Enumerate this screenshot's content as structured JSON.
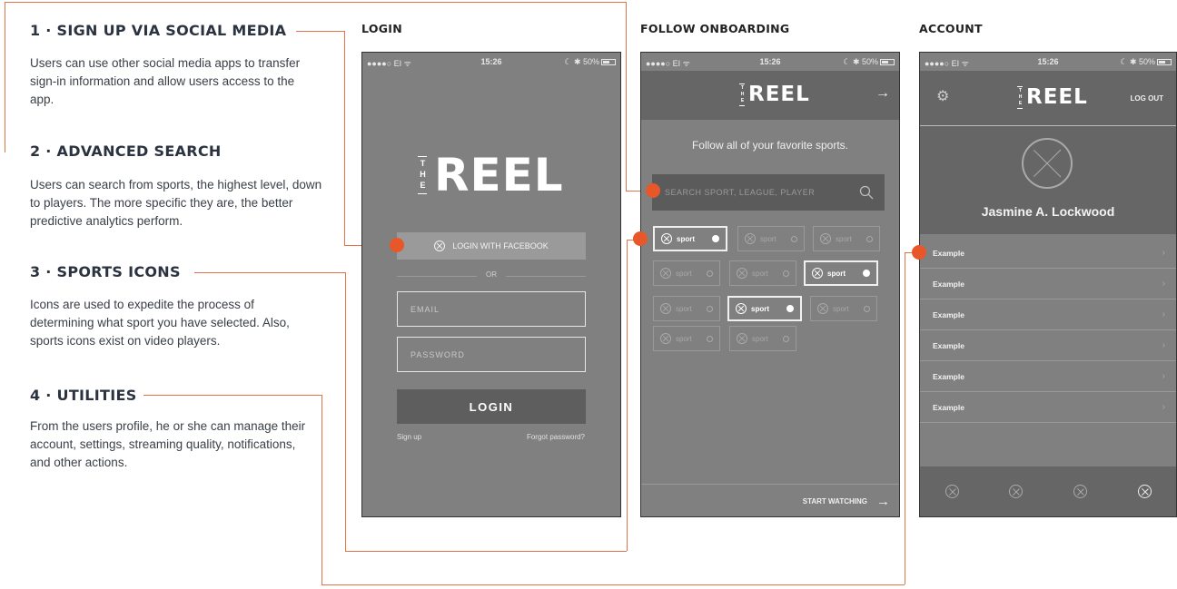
{
  "annotations": [
    {
      "title": "1 · SIGN UP VIA SOCIAL MEDIA",
      "body": "Users can use other social media apps to transfer sign-in information and allow users access to the app."
    },
    {
      "title": "2 · ADVANCED SEARCH",
      "body": "Users can search from sports, the highest level, down to players. The more specific they are, the better predictive analytics perform."
    },
    {
      "title": "3 · SPORTS ICONS",
      "body": "Icons are used to expedite the process of determining what sport you have selected. Also, sports icons exist on video players."
    },
    {
      "title": "4 · UTILITIES",
      "body": "From the users profile, he or she can manage their account, settings, streaming quality, notifications, and other actions."
    }
  ],
  "columns": {
    "login": "LOGIN",
    "onboarding": "FOLLOW ONBOARDING",
    "account": "ACCOUNT"
  },
  "status_bar": {
    "carrier": "●●●●○ EI ᯤ",
    "time": "15:26",
    "battery": "☾ ✱ 50%"
  },
  "logo": {
    "the": "THE",
    "reel": "REEL"
  },
  "login": {
    "facebook_button": "LOGIN WITH FACEBOOK",
    "or": "OR",
    "email_placeholder": "EMAIL",
    "password_placeholder": "PASSWORD",
    "login_button": "LOGIN",
    "sign_up": "Sign up",
    "forgot_password": "Forgot password?"
  },
  "onboarding": {
    "next_arrow": "→",
    "title": "Follow all of your favorite sports.",
    "search_placeholder": "SEARCH SPORT, LEAGUE, PLAYER",
    "chips": [
      {
        "label": "sport",
        "selected": true
      },
      {
        "label": "sport",
        "selected": false
      },
      {
        "label": "sport",
        "selected": false
      },
      {
        "label": "sport",
        "selected": false
      },
      {
        "label": "sport",
        "selected": false
      },
      {
        "label": "sport",
        "selected": true
      },
      {
        "label": "sport",
        "selected": false
      },
      {
        "label": "sport",
        "selected": true
      },
      {
        "label": "sport",
        "selected": false
      },
      {
        "label": "sport",
        "selected": false
      },
      {
        "label": "sport",
        "selected": false
      }
    ],
    "start_watching": "START WATCHING",
    "start_arrow": "→"
  },
  "account": {
    "settings_icon": "⚙",
    "logout": "LOG OUT",
    "name": "Jasmine A. Lockwood",
    "menu_items": [
      "Example",
      "Example",
      "Example",
      "Example",
      "Example",
      "Example"
    ],
    "chevron": "›"
  },
  "colors": {
    "accent": "#e8572a",
    "phone_bg": "#808080",
    "phone_dark": "#666666"
  }
}
